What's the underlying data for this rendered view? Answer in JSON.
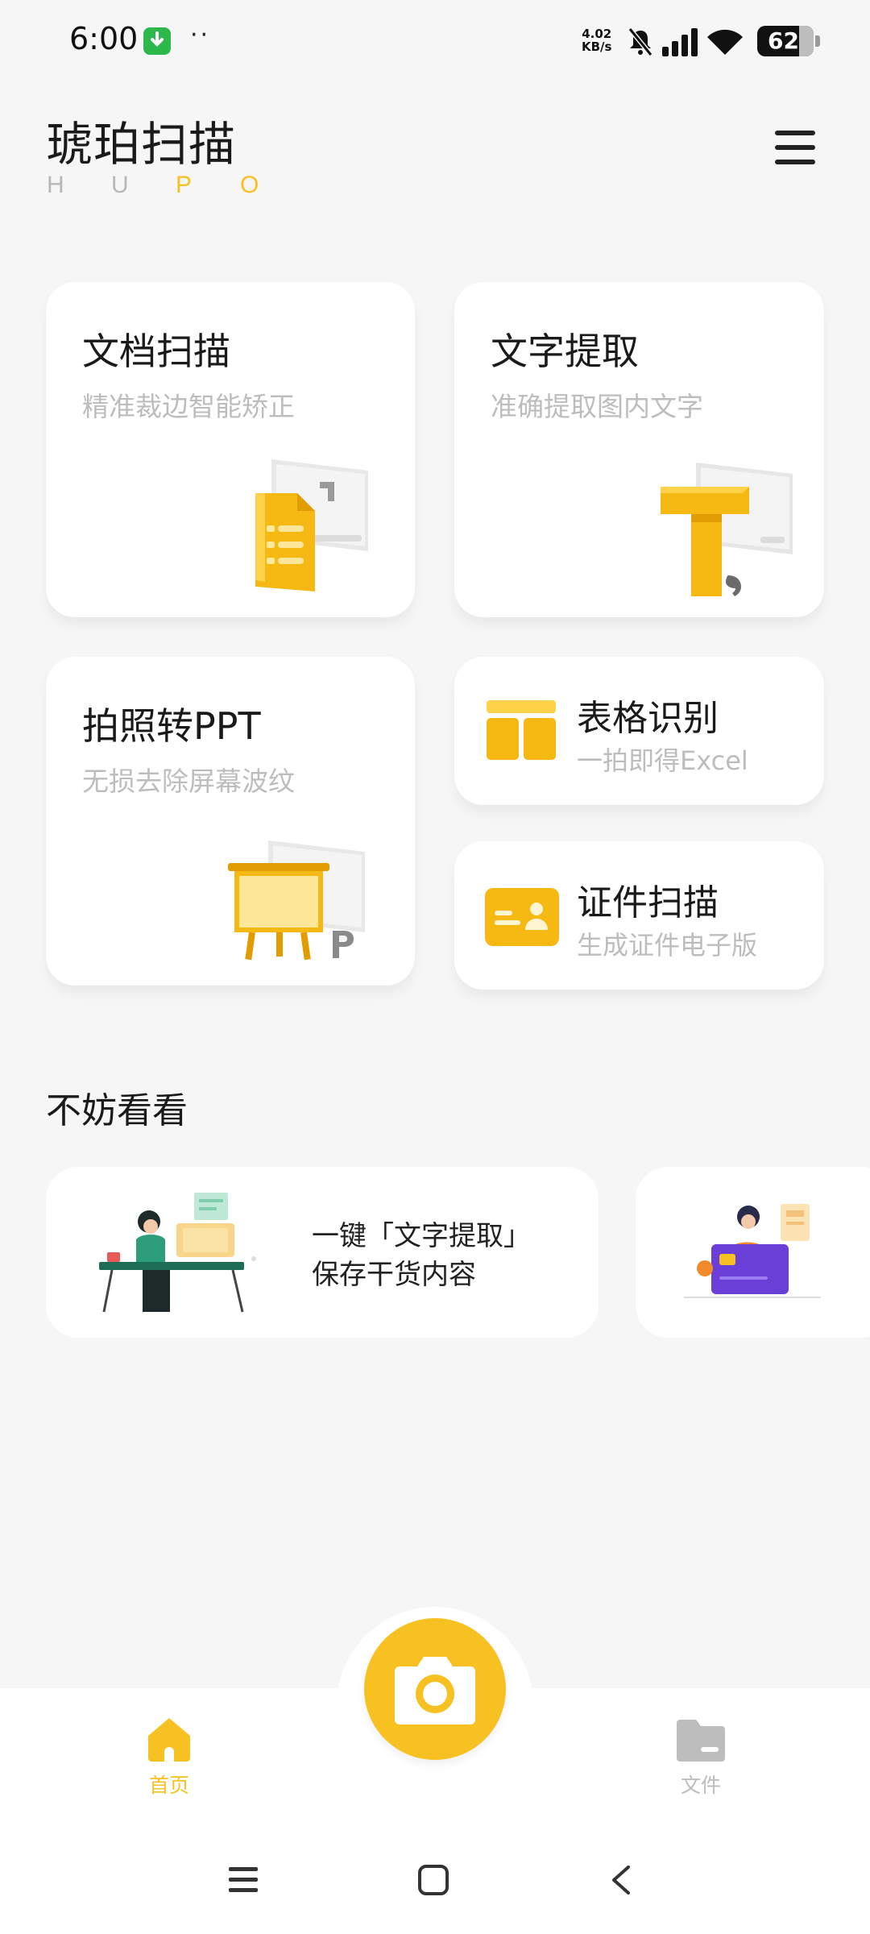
{
  "status_bar": {
    "time": "6:00",
    "dots": "··",
    "speed_value": "4.02",
    "speed_unit": "KB/s",
    "battery": "62"
  },
  "header": {
    "title": "琥珀扫描",
    "subtitle_letters": [
      "H",
      "U",
      "P",
      "O"
    ],
    "menu_icon": "hamburger-menu-icon"
  },
  "features": {
    "doc_scan": {
      "title": "文档扫描",
      "subtitle": "精准裁边智能矫正"
    },
    "text_extract": {
      "title": "文字提取",
      "subtitle": "准确提取图内文字"
    },
    "photo_ppt": {
      "title": "拍照转PPT",
      "subtitle": "无损去除屏幕波纹"
    },
    "table_recog": {
      "title": "表格识别",
      "subtitle": "一拍即得Excel"
    },
    "id_scan": {
      "title": "证件扫描",
      "subtitle": "生成证件电子版"
    }
  },
  "discover": {
    "title": "不妨看看",
    "cards": [
      {
        "line1": "一键「文字提取」",
        "line2": "保存干货内容"
      }
    ]
  },
  "bottom_nav": {
    "home_label": "首页",
    "files_label": "文件",
    "active_color": "#f7c221",
    "inactive_color": "#bdbdbd"
  },
  "colors": {
    "accent": "#f7c221",
    "background": "#f6f6f6"
  }
}
